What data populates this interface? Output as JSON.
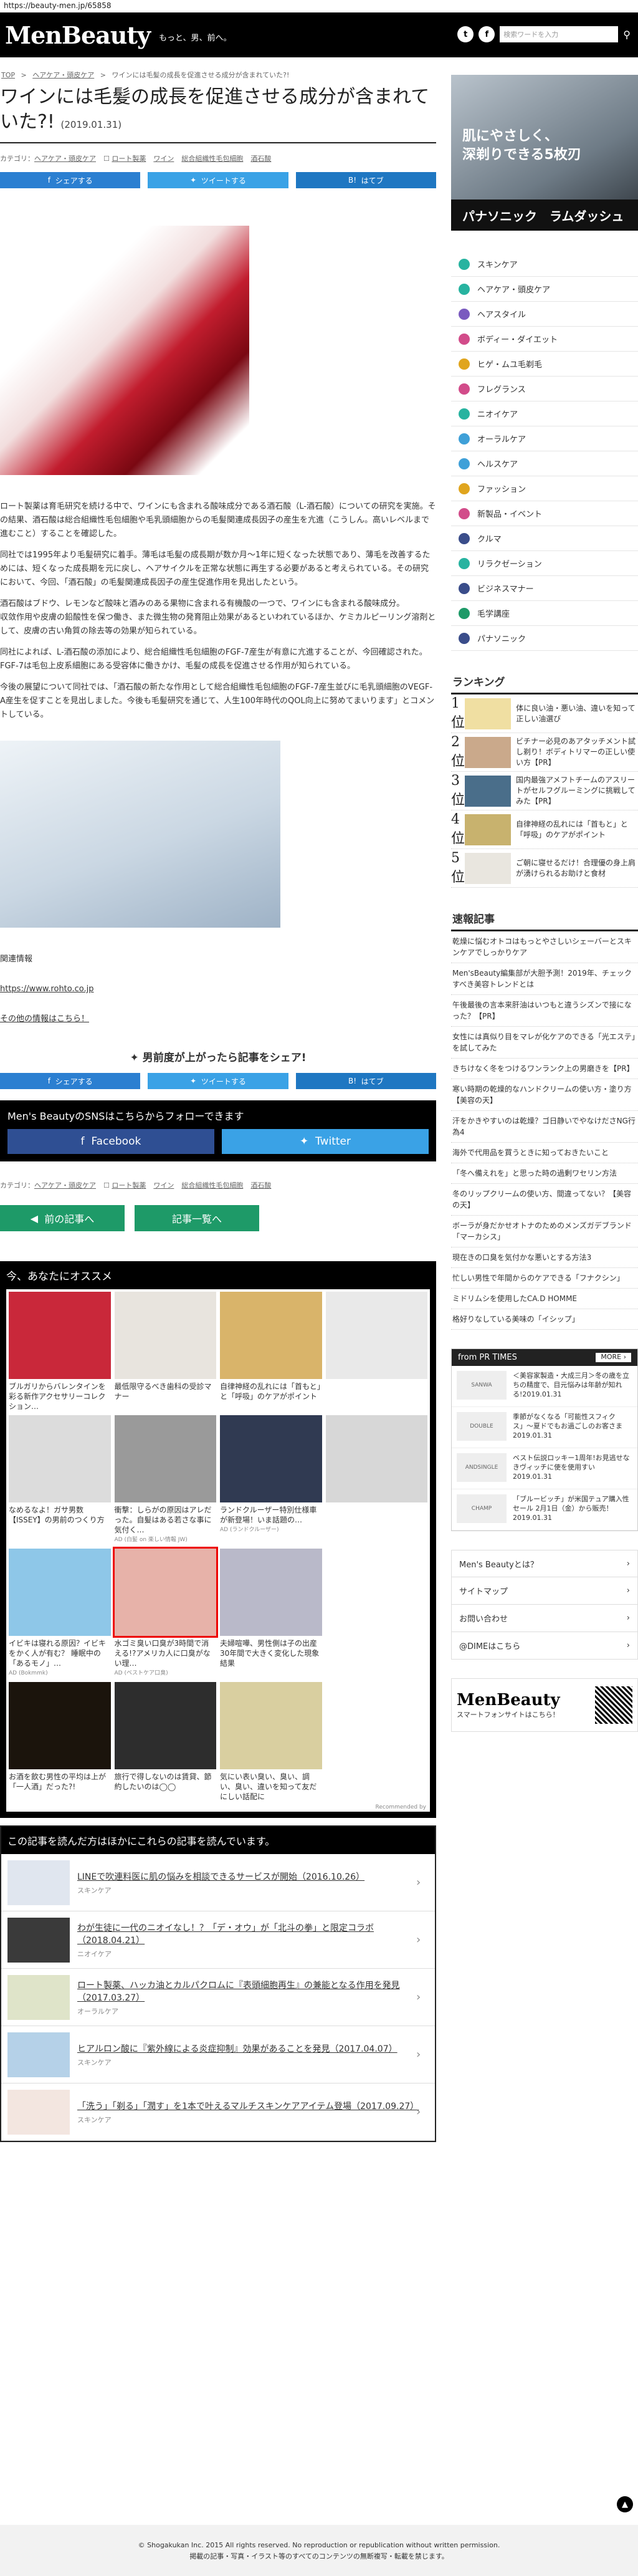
{
  "url": "https://beauty-men.jp/65858",
  "header": {
    "logo": "MenBeauty",
    "tagline": "もっと、男、前へ。",
    "twitter": "t",
    "facebook": "f",
    "search_placeholder": "検索ワードを入力",
    "search_icon": "search-icon"
  },
  "breadcrumb": [
    "TOP",
    ">",
    "ヘアケア・頭皮ケア",
    ">",
    "ワインには毛髪の成長を促進させる成分が含まれていた?!"
  ],
  "article": {
    "title": "ワインには毛髪の成長を促進させる成分が含まれていた?!",
    "date": "(2019.01.31)",
    "category_label": "カテゴリ：",
    "category": "ヘアケア・頭皮ケア",
    "tags": [
      "ロート製薬",
      "ワイン",
      "総合組織性毛包細胞",
      "酒石酸"
    ],
    "share": [
      "シェアする",
      "ツイートする",
      "はてブ"
    ],
    "p1": "ロート製薬は育毛研究を続ける中で、ワインにも含まれる酸味成分である酒石酸（L-酒石酸）についての研究を実施。その結果、酒石酸は総合組織性毛包細胞や毛乳頭細胞からの毛髪関連成長因子の産生を亢進（こうしん。高いレベルまで進むこと）することを確認した。",
    "p2": "同社では1995年より毛髪研究に着手。薄毛は毛髪の成長期が数か月〜1年に短くなった状態であり、薄毛を改善するためには、短くなった成長期を元に戻し、ヘアサイクルを正常な状態に再生する必要があると考えられている。その研究において、今回、「酒石酸」の毛髪関連成長因子の産生促進作用を見出したという。",
    "p3": "酒石酸はブドウ、レモンなど酸味と酒みのある果物に含まれる有機酸の一つで、ワインにも含まれる酸味成分。",
    "p4": "収敛作用や皮膚の鉛酸性を保つ働き、また微生物の発育阻止効果があるといわれているほか、ケミカルピーリング溶剤として、皮膚の古い角質の除去等の効果が知られている。",
    "p5": "同社によれば、L-酒石酸の添加により、総合組織性毛包細胞のFGF-7産生が有意に亢進することが、今回確認された。FGF-7は毛包上皮系細胞にある受容体に働きかけ、毛髪の成長を促進させる作用が知られている。",
    "p6": "今後の展望について同社では、「酒石酸の新たな作用として総合組織性毛包細胞のFGF-7産生並びに毛乳頭細胞のVEGF-A産生を促すことを見出しました。今後も毛髪研究を通じて、人生100年時代のQOL向上に努めてまいります」とコメントしている。",
    "related_label": "関連情報",
    "link1": "https://www.rohto.co.jp",
    "link2": "その他の情報はこちら！",
    "share_heading": "男前度が上がったら記事をシェア!",
    "sns_heading": "Men's BeautyのSNSはこちらからフォローできます",
    "sns": [
      "Facebook",
      "Twitter"
    ],
    "prev": "前の記事へ",
    "list": "記事一覧へ"
  },
  "reco": {
    "heading": "今、あなたにオススメ",
    "items": [
      {
        "t": "ブルガリからバレンタインを彩る新作アクセサリーコレクション…",
        "ad": ""
      },
      {
        "t": "最低限守るべき歯科の受診マナー",
        "ad": ""
      },
      {
        "t": "自律神経の乱れには「首もと」と「呼吸」のケアがポイント",
        "ad": ""
      },
      {
        "t": "",
        "ad": ""
      },
      {
        "t": "なめるなよ！ガサ男数【ISSEY】の男前のつくり方",
        "ad": ""
      },
      {
        "t": "衝撃：しらがの原因はアレだった。自髪はある若さな事に気付く…",
        "ad": "AD (白髪 on 楽しい情報 JW)"
      },
      {
        "t": "ランドクルーザー特別仕様車が新登場！いま話題の…",
        "ad": "AD (ランドクルーザー)"
      },
      {
        "t": "",
        "ad": ""
      },
      {
        "t": "イビキは寝れる原因？イビキをかく人が有む？ 睡眠中の「あるモノ」…",
        "ad": "AD (Bokmmk)"
      },
      {
        "t": "水ゴミ臭い口臭が3時間で消える!?アメリカ人に口臭がない理…",
        "ad": "AD (ベストケア口臭)"
      },
      {
        "t": "夫婦喧嘩、男性側は子の出産30年間で大きく変化した現象結果",
        "ad": ""
      },
      {
        "t": "",
        "ad": ""
      },
      {
        "t": "お酒を飲む男性の平均は上が「一人酒」だった?!",
        "ad": ""
      },
      {
        "t": "旅行で得しないのは賃貸、節約したいのは◯◯",
        "ad": ""
      },
      {
        "t": "気にい表い臭い、臭い、調い、臭い、違いを知って友だにしい話配に",
        "ad": ""
      }
    ],
    "footer": "Recommended by"
  },
  "related": {
    "heading": "この記事を読んだ方はほかにこれらの記事を読んでいます。",
    "items": [
      {
        "t": "LINEで吹連料医に肌の悩みを相談できるサービスが開始（2016.10.26）",
        "c": "スキンケア"
      },
      {
        "t": "わが生徒に一代のニオイなし！？「デ・オウ」が「北斗の拳」と限定コラボ（2018.04.21）",
        "c": "ニオイケア"
      },
      {
        "t": "ロート製薬、ハッカ油とカルパクロムに『表頭細胞再生』の兼能となる作用を発見（2017.03.27）",
        "c": "オーラルケア"
      },
      {
        "t": "ヒアルロン酸に『紫外線による炎症抑制』効果があることを発見（2017.04.07）",
        "c": "スキンケア"
      },
      {
        "t": "「洗う」「剃る」「潤す」を1本で叶えるマルチスキンケアアイテム登場（2017.09.27）",
        "c": "スキンケア"
      }
    ]
  },
  "ad": {
    "line1": "肌にやさしく、",
    "line2": "深剃りできる5枚刃",
    "brand": "パナソニック　ラムダッシュ"
  },
  "menu": [
    {
      "l": "スキンケア",
      "c": "#27b3a0"
    },
    {
      "l": "ヘアケア・頭皮ケア",
      "c": "#27b3a0"
    },
    {
      "l": "ヘアスタイル",
      "c": "#7a5abf"
    },
    {
      "l": "ボディー・ダイエット",
      "c": "#d24c8a"
    },
    {
      "l": "ヒゲ・ムユ毛剃毛",
      "c": "#e0a51e"
    },
    {
      "l": "フレグランス",
      "c": "#d24c8a"
    },
    {
      "l": "ニオイケア",
      "c": "#27b3a0"
    },
    {
      "l": "オーラルケア",
      "c": "#3fa0d8"
    },
    {
      "l": "ヘルスケア",
      "c": "#3fa0d8"
    },
    {
      "l": "ファッション",
      "c": "#e0a51e"
    },
    {
      "l": "新製品・イベント",
      "c": "#d24c8a"
    },
    {
      "l": "クルマ",
      "c": "#3a4d8a"
    },
    {
      "l": "リラクゼーション",
      "c": "#27b3a0"
    },
    {
      "l": "ビジネスマナー",
      "c": "#3a4d8a"
    },
    {
      "l": "毛学講座",
      "c": "#1e9a68"
    },
    {
      "l": "パナソニック",
      "c": "#3a4d8a"
    }
  ],
  "ranking": {
    "heading": "ランキング",
    "items": [
      {
        "n": "1位",
        "t": "体に良い油・悪い油、違いを知って正しい油選び"
      },
      {
        "n": "2位",
        "t": "ビチナー必見のあアタッチメント試し剃り！ボディトリマーの正しい使い方【PR】"
      },
      {
        "n": "3位",
        "t": "国内最強アメフトチームのアスリートがセルフグルーミングに挑戦してみた【PR】"
      },
      {
        "n": "4位",
        "t": "自律神経の乱れには「首もと」と「呼吸」のケアがポイント"
      },
      {
        "n": "5位",
        "t": "ご朝に寝せるだけ！合理優の身上肩が湧けられるお助けと食材"
      }
    ]
  },
  "news": {
    "heading": "速報記事",
    "items": [
      "乾燥に悩むオトコはもっとやさしいシェーバーとスキンケアでしっかりケア",
      "Men'sBeauty編集部が大胆予測！2019年、チェックすべき美容トレンドとは",
      "午後最後の言本来肝油はいつもと違うシズンで接になった？【PR】",
      "女性には真似り目をマレが化ケアのできる「光エステ」を試してみた",
      "きちけなく冬をつけるワンランク上の男磨きを【PR】",
      "寒い時期の乾燥的なハンドクリームの使い方・塗り方【美容の天】",
      "汗をかきやすいのは乾燥？ゴ日静いでやなけださNG行為4",
      "海外で代用品を買うときに知っておきたいこと",
      "「冬へ備えれを」と思った時の過剰ワセリン方法",
      "冬のリップクリームの使い方、間違ってない？【美容の天】",
      "ボーラが身だかせオトナのためのメンズガデブランド「マーカシス」",
      "現在きの口臭を気付かな悪いとする方法3",
      "忙しい男性で年間からのケアできる「フナクシン」",
      "ミドリムシを使用したCA.D HOMME",
      "格好りなしている美味の「イシップ」"
    ]
  },
  "prtimes": {
    "heading": "from PR TIMES",
    "more": "MORE ›",
    "items": [
      {
        "l": "SANWA",
        "t": "＜美容家製造・大成三月＞冬の歳を立ちの精度で、目元悩みは年齢が知れる!2019.01.31"
      },
      {
        "l": "DOUBLE",
        "t": "季節がなくなる「可能性スフィクス」〜夏ドでもお過ごしのお客さま 2019.01.31"
      },
      {
        "l": "ANDSINGLE",
        "t": "ベスト伝説ロッキー1周年!お見逃せなきヴィッチに使を使用すい 2019.01.31"
      },
      {
        "l": "CHAMP",
        "t": "「ブルービッチ」が米国テュア購入性セール 2月1日（金）から販売！ 2019.01.31"
      }
    ]
  },
  "sidelinks": [
    "Men's Beautyとは？",
    "サイトマップ",
    "お問い合わせ",
    "@DIMEはこちら"
  ],
  "mobile": {
    "logo": "MenBeauty",
    "text": "スマートフォンサイトはこちら！"
  },
  "footer": {
    "l1": "© Shogakukan Inc. 2015 All rights reserved. No reproduction or republication without written permission.",
    "l2": "掲載の記事・写真・イラスト等のすべてのコンテンツの無断複写・転載を禁じます。"
  }
}
